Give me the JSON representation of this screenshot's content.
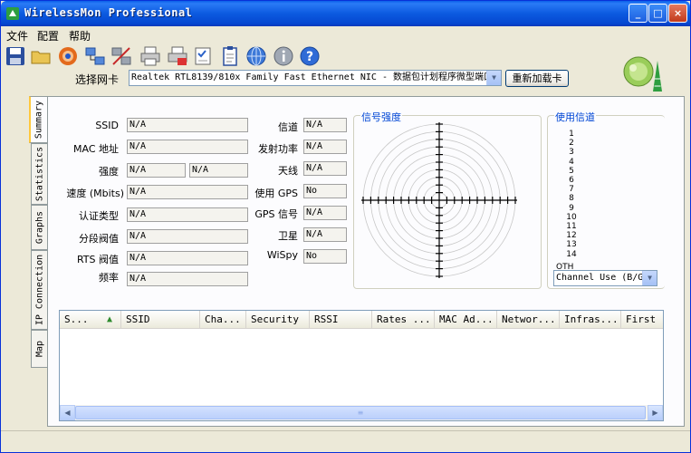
{
  "window": {
    "title": "WirelessMon Professional"
  },
  "titlebar_buttons": {
    "minimize": "_",
    "maximize": "□",
    "close": "×"
  },
  "menu": [
    "文件",
    "配置",
    "帮助"
  ],
  "toolbar": {
    "icons": [
      "save-icon",
      "open-folder-icon",
      "record-icon",
      "network-icon",
      "disconnect-icon",
      "print-icon",
      "print-settings-icon",
      "checklist-icon",
      "clipboard-icon",
      "globe-icon",
      "info-icon",
      "help-icon"
    ]
  },
  "nic": {
    "label": "选择网卡",
    "selected": "Realtek RTL8139/810x Family Fast Ethernet NIC - 数据包计划程序微型端口",
    "reload_label": "重新加载卡"
  },
  "tabs": [
    "Summary",
    "Statistics",
    "Graphs",
    "IP Connection",
    "Map"
  ],
  "fields_left": [
    {
      "label": "SSID",
      "value": "N/A"
    },
    {
      "label": "MAC 地址",
      "value": "N/A"
    },
    {
      "label": "强度",
      "value": "N/A",
      "value2": "N/A"
    },
    {
      "label": "速度 (Mbits)",
      "value": "N/A"
    },
    {
      "label": "认证类型",
      "value": "N/A"
    },
    {
      "label": "分段阀值",
      "value": "N/A"
    },
    {
      "label": "RTS 阀值",
      "value": "N/A"
    },
    {
      "label": "频率",
      "value": "N/A"
    }
  ],
  "fields_mid": [
    {
      "label": "信道",
      "value": "N/A"
    },
    {
      "label": "发射功率",
      "value": "N/A"
    },
    {
      "label": "天线",
      "value": "N/A"
    },
    {
      "label": "使用 GPS",
      "value": "No"
    },
    {
      "label": "GPS 信号",
      "value": "N/A"
    },
    {
      "label": "卫星",
      "value": "N/A"
    },
    {
      "label": "WiSpy",
      "value": "No"
    }
  ],
  "signal_group": {
    "title": "信号强度"
  },
  "channel_group": {
    "title": "使用信道",
    "channels": [
      "1",
      "2",
      "3",
      "4",
      "5",
      "6",
      "7",
      "8",
      "9",
      "10",
      "11",
      "12",
      "13",
      "14"
    ],
    "other": "OTH",
    "select_value": "Channel Use (B/G)"
  },
  "list": {
    "columns": [
      "S...",
      "SSID",
      "Cha...",
      "Security",
      "RSSI",
      "Rates ...",
      "MAC Ad...",
      "Networ...",
      "Infras...",
      "First"
    ],
    "sort_arrow": "▲"
  },
  "scroll": {
    "left": "◀",
    "right": "▶",
    "thumb_grip": "≡"
  },
  "colors": {
    "title_blue": "#0A5FE8",
    "group_title": "#0046D5",
    "window_bg": "#ECE9D8"
  }
}
